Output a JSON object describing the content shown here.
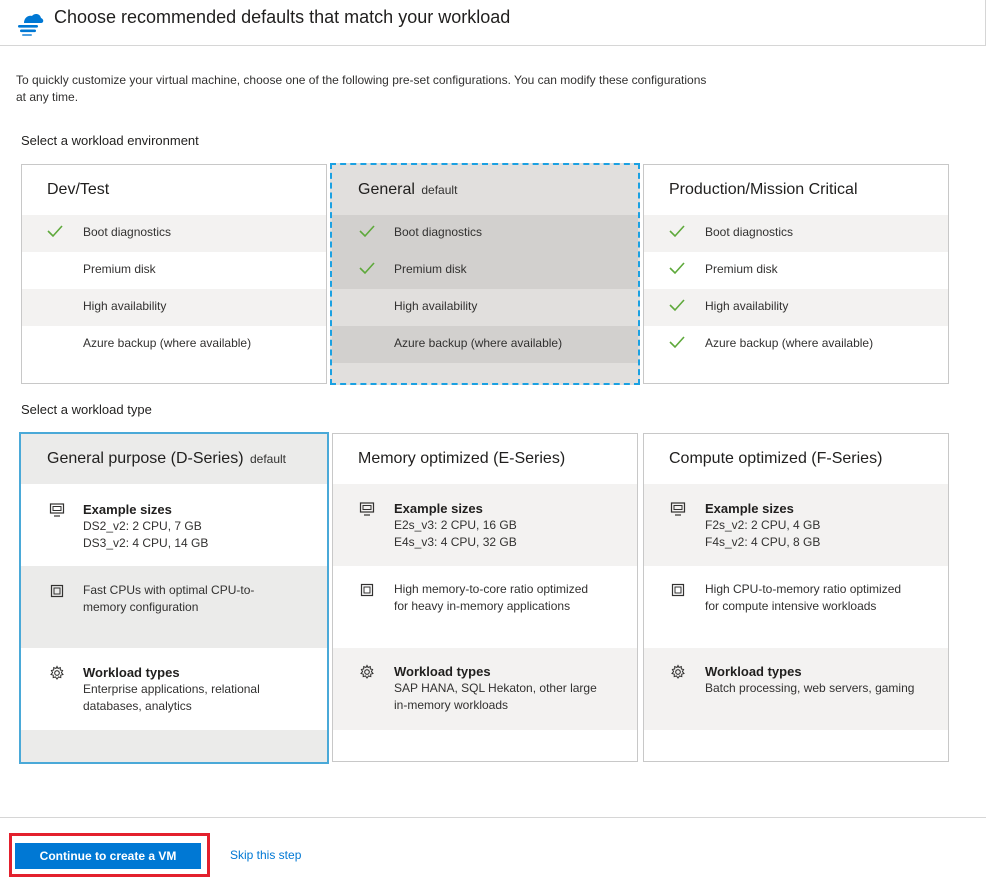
{
  "header": {
    "title": "Choose recommended defaults that match your workload",
    "logo_icon": "azure-cloud-icon"
  },
  "intro": "To quickly customize your virtual machine, choose one of the following pre-set configurations. You can modify these configurations at any time.",
  "environment": {
    "label": "Select a workload environment",
    "features": [
      "Boot diagnostics",
      "Premium disk",
      "High availability",
      "Azure backup (where available)"
    ],
    "cards": [
      {
        "title": "Dev/Test",
        "default": "",
        "checks": [
          true,
          false,
          false,
          false
        ]
      },
      {
        "title": "General",
        "default": "default",
        "checks": [
          true,
          true,
          false,
          false
        ],
        "selected": true
      },
      {
        "title": "Production/Mission Critical",
        "default": "",
        "checks": [
          true,
          true,
          true,
          true
        ]
      }
    ]
  },
  "workload_type": {
    "label": "Select a workload type",
    "sizes_heading": "Example sizes",
    "types_heading": "Workload types",
    "cards": [
      {
        "title": "General purpose (D-Series)",
        "default": "default",
        "size1": "DS2_v2: 2 CPU, 7 GB",
        "size2": "DS3_v2: 4 CPU, 14 GB",
        "desc1": "Fast CPUs with optimal CPU-to-",
        "desc2": "memory configuration",
        "types1": "Enterprise applications, relational",
        "types2": "databases, analytics",
        "selected": true
      },
      {
        "title": "Memory optimized (E-Series)",
        "default": "",
        "size1": "E2s_v3: 2 CPU, 16 GB",
        "size2": "E4s_v3: 4 CPU, 32 GB",
        "desc1": "High memory-to-core ratio optimized",
        "desc2": "for heavy in-memory applications",
        "types1": "SAP HANA, SQL Hekaton, other large",
        "types2": "in-memory workloads"
      },
      {
        "title": "Compute optimized (F-Series)",
        "default": "",
        "size1": "F2s_v2: 2 CPU, 4 GB",
        "size2": "F4s_v2: 4 CPU, 8 GB",
        "desc1": "High CPU-to-memory ratio optimized",
        "desc2": "for compute intensive workloads",
        "types1": "Batch processing, web servers, gaming",
        "types2": ""
      }
    ]
  },
  "footer": {
    "primary_button": "Continue to create a VM",
    "skip_link": "Skip this step"
  },
  "colors": {
    "accent": "#0078d4",
    "check": "#5ea93b",
    "selection": "#1ba1e2",
    "highlight": "#e3202d"
  }
}
